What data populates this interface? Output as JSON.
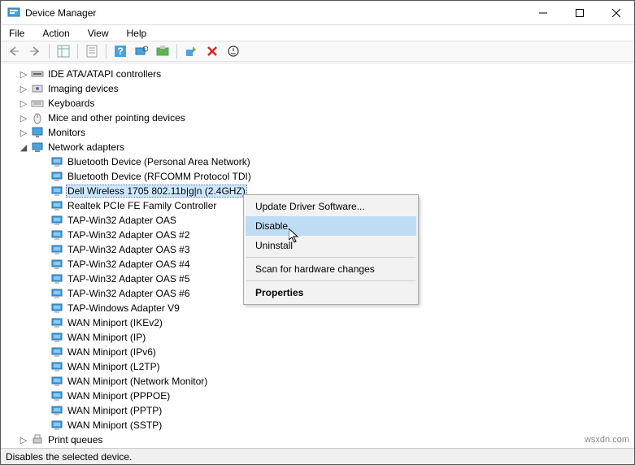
{
  "window": {
    "title": "Device Manager"
  },
  "menubar": [
    "File",
    "Action",
    "View",
    "Help"
  ],
  "statusbar": "Disables the selected device.",
  "watermark": "wsxdn.com",
  "tree": {
    "categories": [
      {
        "expander": "▷",
        "icon": "ide-icon",
        "label": "IDE ATA/ATAPI controllers"
      },
      {
        "expander": "▷",
        "icon": "imaging-icon",
        "label": "Imaging devices"
      },
      {
        "expander": "▷",
        "icon": "keyboard-icon",
        "label": "Keyboards"
      },
      {
        "expander": "▷",
        "icon": "mouse-icon",
        "label": "Mice and other pointing devices"
      },
      {
        "expander": "▷",
        "icon": "monitor-icon",
        "label": "Monitors"
      },
      {
        "expander": "◢",
        "icon": "network-icon",
        "label": "Network adapters",
        "expanded": true
      },
      {
        "expander": "▷",
        "icon": "print-icon",
        "label": "Print queues"
      }
    ],
    "network_children": [
      "Bluetooth Device (Personal Area Network)",
      "Bluetooth Device (RFCOMM Protocol TDI)",
      "Dell Wireless 1705 802.11b|g|n (2.4GHZ)",
      "Realtek PCIe FE Family Controller",
      "TAP-Win32 Adapter OAS",
      "TAP-Win32 Adapter OAS #2",
      "TAP-Win32 Adapter OAS #3",
      "TAP-Win32 Adapter OAS #4",
      "TAP-Win32 Adapter OAS #5",
      "TAP-Win32 Adapter OAS #6",
      "TAP-Windows Adapter V9",
      "WAN Miniport (IKEv2)",
      "WAN Miniport (IP)",
      "WAN Miniport (IPv6)",
      "WAN Miniport (L2TP)",
      "WAN Miniport (Network Monitor)",
      "WAN Miniport (PPPOE)",
      "WAN Miniport (PPTP)",
      "WAN Miniport (SSTP)"
    ],
    "selected_index": 2
  },
  "context_menu": {
    "items": [
      {
        "label": "Update Driver Software...",
        "hover": false
      },
      {
        "label": "Disable",
        "hover": true
      },
      {
        "label": "Uninstall",
        "hover": false
      },
      {
        "sep": true
      },
      {
        "label": "Scan for hardware changes",
        "hover": false
      },
      {
        "sep": true
      },
      {
        "label": "Properties",
        "hover": false,
        "bold": true
      }
    ]
  }
}
